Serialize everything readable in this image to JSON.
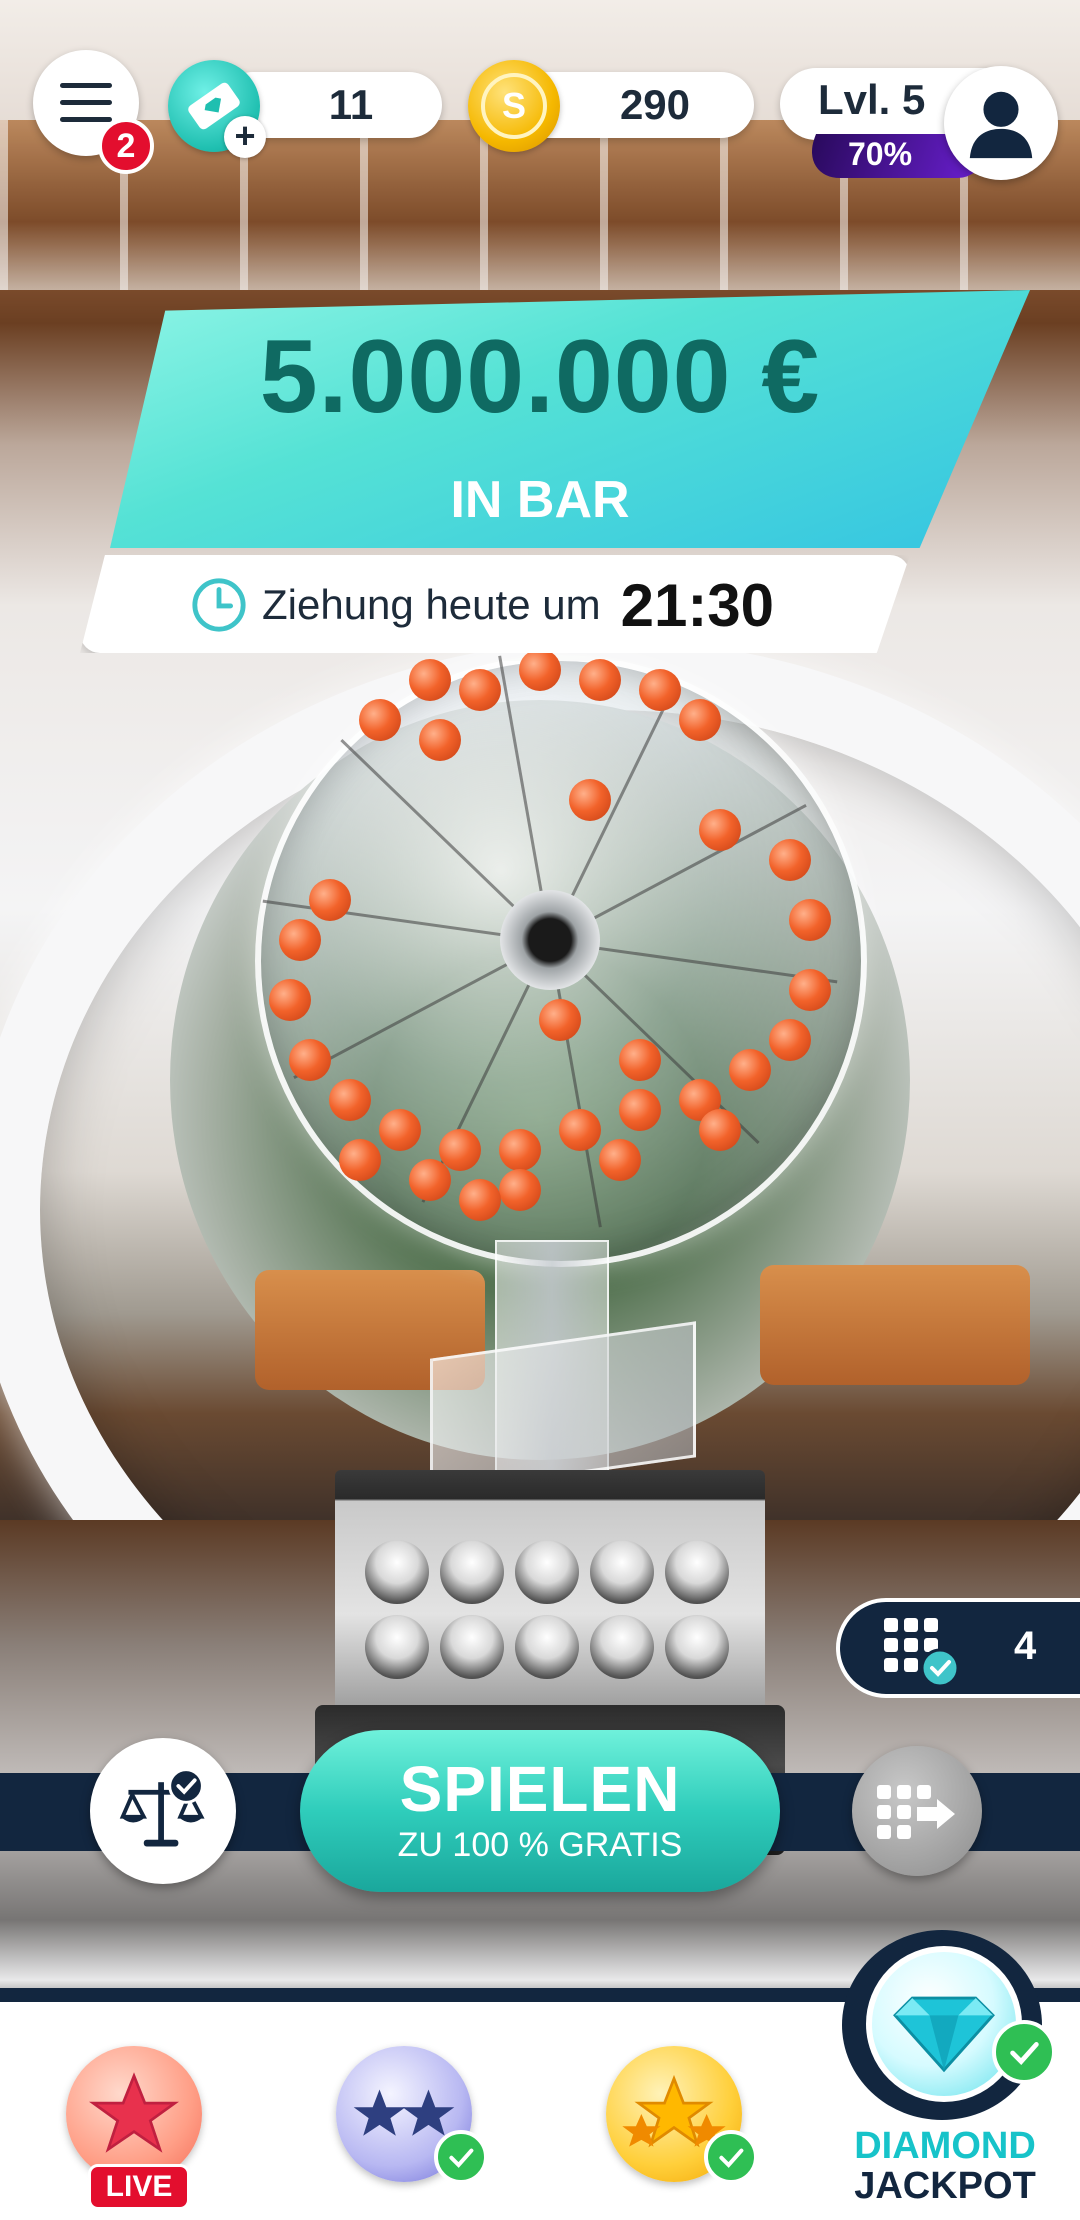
{
  "header": {
    "menu_badge": "2",
    "tickets_count": "11",
    "coins_count": "290",
    "coin_symbol": "S",
    "level_label": "Lvl. 5",
    "level_progress_label": "70%",
    "level_progress": 0.7
  },
  "jackpot": {
    "amount": "5.000.000 €",
    "subtitle": "IN BAR",
    "draw_label": "Ziehung heute um",
    "draw_time": "21:30"
  },
  "play": {
    "main_label": "SPIELEN",
    "sub_label": "ZU 100 % GRATIS",
    "tickets_badge": "4"
  },
  "bottom_nav": {
    "live_label": "LIVE",
    "diamond_line1": "DIAMOND",
    "diamond_line2": "JACKPOT"
  },
  "colors": {
    "teal": "#2fcdbb",
    "navy": "#12263f",
    "red_badge": "#e30e2e",
    "check_green": "#2fbf54",
    "coin_gold": "#f5b800",
    "level_purple": "#6a1fd0"
  },
  "icons": [
    "menu-icon",
    "ticket-icon",
    "plus-icon",
    "coin-icon",
    "user-icon",
    "clock-icon",
    "scale-check-icon",
    "grid-arrow-icon",
    "grid-check-icon",
    "star-icon",
    "diamond-icon",
    "check-icon"
  ]
}
